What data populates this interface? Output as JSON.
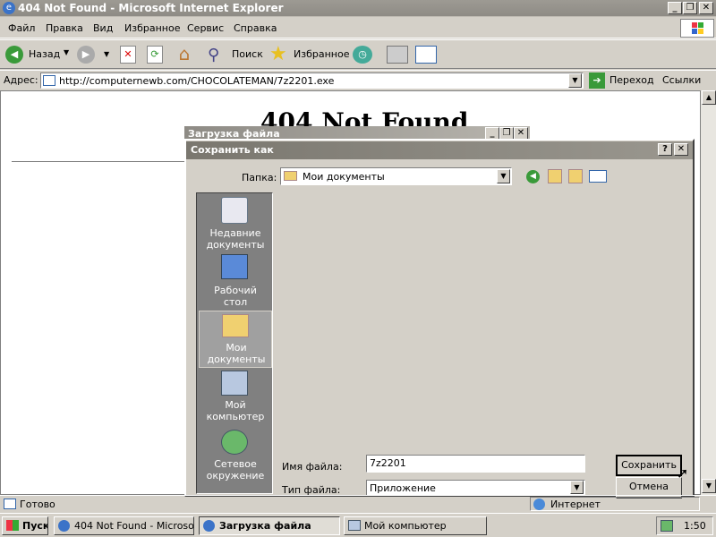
{
  "ie": {
    "title": "404 Not Found - Microsoft Internet Explorer",
    "menu": [
      "Файл",
      "Правка",
      "Вид",
      "Избранное",
      "Сервис",
      "Справка"
    ],
    "toolbar": {
      "back": "Назад",
      "search": "Поиск",
      "favorites": "Избранное"
    },
    "address": {
      "label": "Адрес:",
      "url": "http://computernewb.com/CHOCOLATEMAN/7z2201.exe",
      "go": "Переход",
      "links": "Ссылки"
    },
    "page_heading": "404 Not Found",
    "status": {
      "text": "Готово",
      "zone": "Интернет"
    }
  },
  "download_window": {
    "title": "Загрузка файла"
  },
  "save_dialog": {
    "title": "Сохранить как",
    "folder_label": "Папка:",
    "folder_value": "Мои документы",
    "places": [
      {
        "label": "Недавние документы",
        "icon": "recent-documents-icon"
      },
      {
        "label": "Рабочий стол",
        "icon": "desktop-icon"
      },
      {
        "label": "Мои документы",
        "icon": "my-documents-icon"
      },
      {
        "label": "Мой компьютер",
        "icon": "my-computer-icon"
      },
      {
        "label": "Сетевое окружение",
        "icon": "network-icon"
      }
    ],
    "filename_label": "Имя файла:",
    "filename_value": "7z2201",
    "filetype_label": "Тип файла:",
    "filetype_value": "Приложение",
    "save_label": "Сохранить",
    "cancel_label": "Отмена"
  },
  "taskbar": {
    "start": "Пуск",
    "tasks": [
      "404 Not Found - Microso...",
      "Загрузка файла",
      "Мой компьютер"
    ],
    "clock": "1:50"
  }
}
